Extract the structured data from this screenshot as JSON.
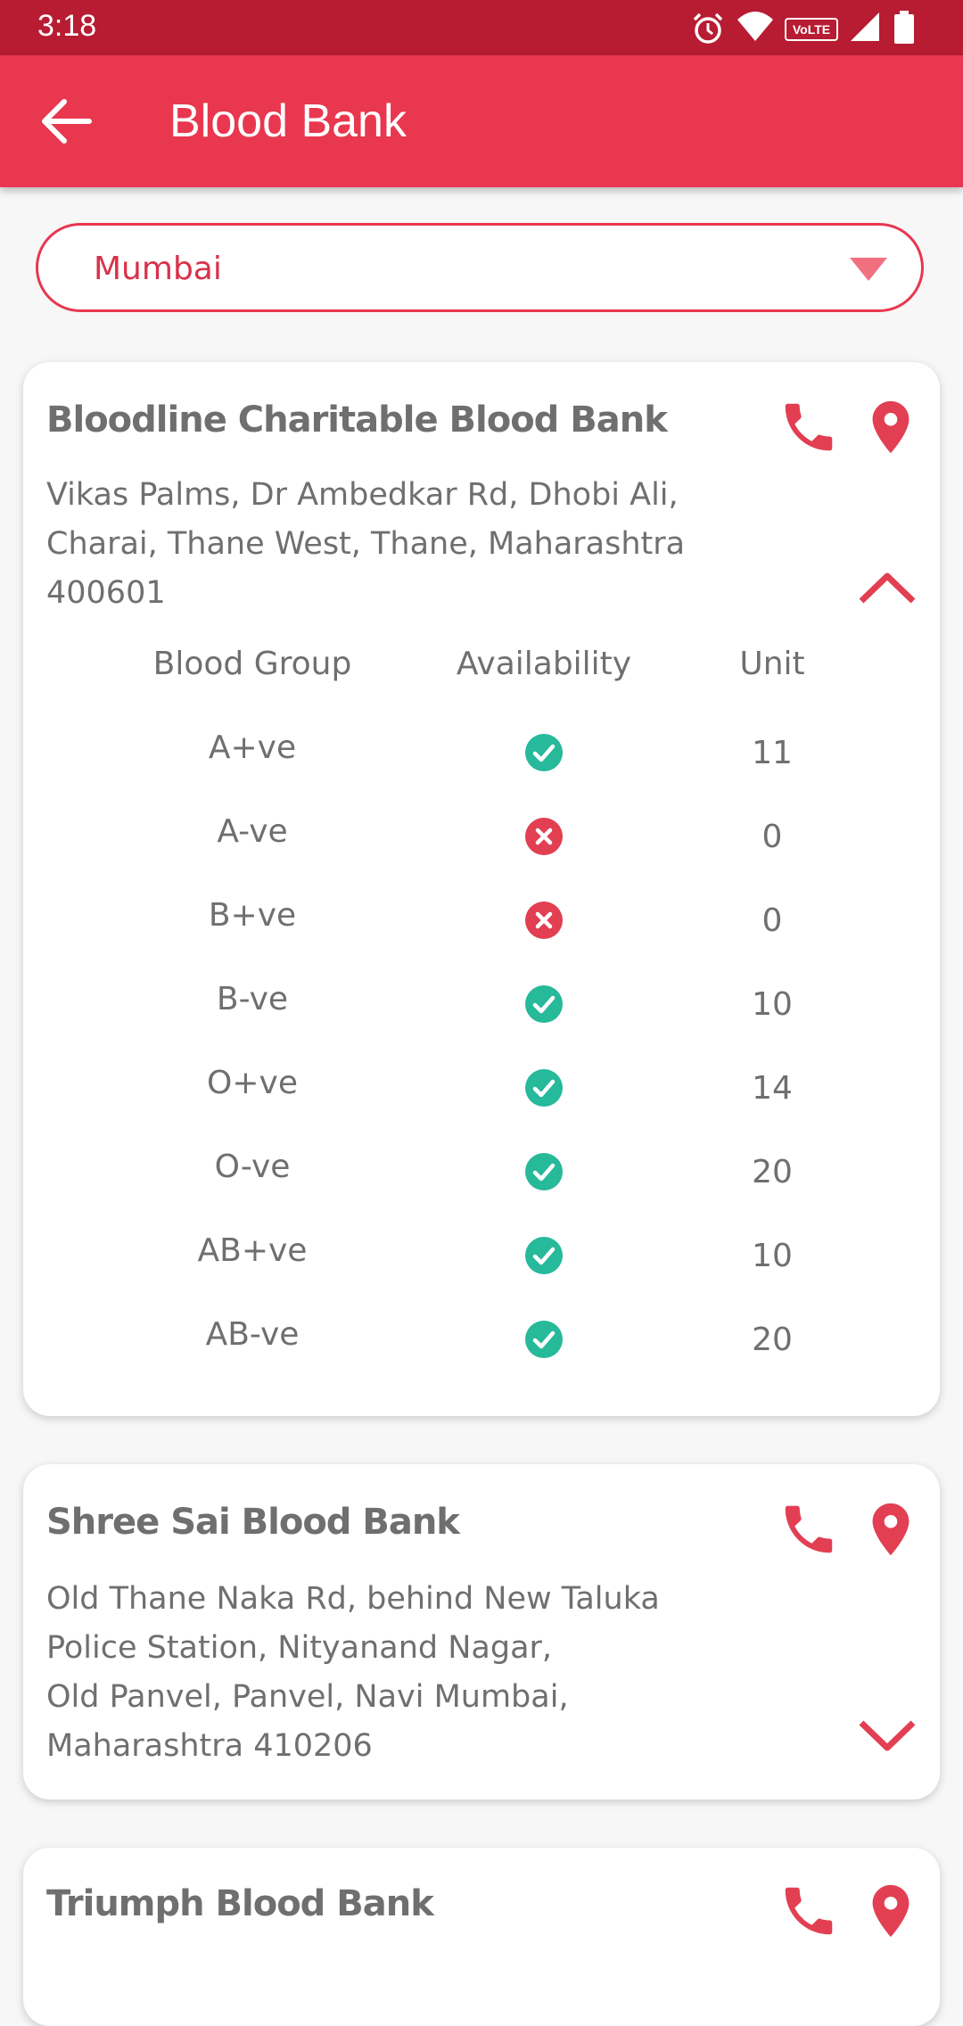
{
  "status_bar": {
    "time": "3:18",
    "network_badge": "VoLTE",
    "icons": [
      "alarm-icon",
      "wifi-icon",
      "volte-icon",
      "signal-icon",
      "battery-icon"
    ]
  },
  "app_bar": {
    "title": "Blood Bank",
    "back_icon": "arrow-left-icon",
    "color": "#e8374f",
    "status_color": "#b71c32"
  },
  "city_select": {
    "value": "Mumbai",
    "caret_icon": "triangle-down-icon"
  },
  "table_headers": {
    "group": "Blood Group",
    "availability": "Availability",
    "unit": "Unit"
  },
  "colors": {
    "accent": "#e8374f",
    "available": "#26b99a",
    "unavailable": "#e23f52",
    "text": "#6f6f6f"
  },
  "banks": [
    {
      "name": "Bloodline Charitable Blood Bank",
      "address": "Vikas Palms, Dr Ambedkar Rd, Dhobi Ali,\nCharai, Thane West, Thane, Maharashtra\n400601",
      "expanded": true,
      "stock": [
        {
          "group": "A+ve",
          "available": true,
          "units": "11"
        },
        {
          "group": "A-ve",
          "available": false,
          "units": "0"
        },
        {
          "group": "B+ve",
          "available": false,
          "units": "0"
        },
        {
          "group": "B-ve",
          "available": true,
          "units": "10"
        },
        {
          "group": "O+ve",
          "available": true,
          "units": "14"
        },
        {
          "group": "O-ve",
          "available": true,
          "units": "20"
        },
        {
          "group": "AB+ve",
          "available": true,
          "units": "10"
        },
        {
          "group": "AB-ve",
          "available": true,
          "units": "20"
        }
      ]
    },
    {
      "name": "Shree Sai Blood Bank",
      "address": "Old Thane Naka Rd, behind New Taluka\nPolice Station, Nityanand Nagar,\nOld Panvel, Panvel, Navi Mumbai,\nMaharashtra 410206",
      "expanded": false
    },
    {
      "name": "Triumph Blood Bank",
      "address": "",
      "expanded": false
    }
  ]
}
